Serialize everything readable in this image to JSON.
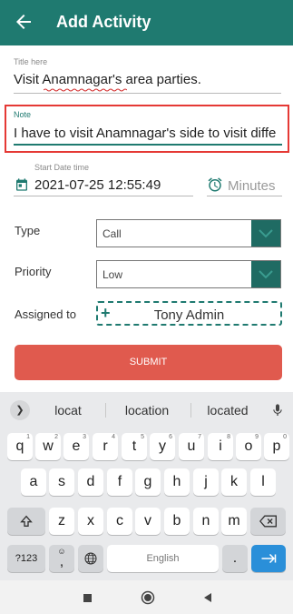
{
  "appbar": {
    "title": "Add Activity"
  },
  "form": {
    "title_label": "Title here",
    "title_value": "Visit Anamnagar's area parties.",
    "note_label": "Note",
    "note_value": "I have to visit Anamnagar's side to visit diffe",
    "start_label": "Start Date time",
    "start_value": "2021-07-25 12:55:49",
    "minutes_placeholder": "Minutes",
    "type_label": "Type",
    "type_value": "Call",
    "priority_label": "Priority",
    "priority_value": "Low",
    "assigned_label": "Assigned to",
    "assigned_value": "Tony Admin",
    "submit_label": "SUBMIT"
  },
  "keyboard": {
    "suggestions": [
      "locat",
      "location",
      "located"
    ],
    "row1": [
      {
        "k": "q",
        "h": "1"
      },
      {
        "k": "w",
        "h": "2"
      },
      {
        "k": "e",
        "h": "3"
      },
      {
        "k": "r",
        "h": "4"
      },
      {
        "k": "t",
        "h": "5"
      },
      {
        "k": "y",
        "h": "6"
      },
      {
        "k": "u",
        "h": "7"
      },
      {
        "k": "i",
        "h": "8"
      },
      {
        "k": "o",
        "h": "9"
      },
      {
        "k": "p",
        "h": "0"
      }
    ],
    "row2": [
      "a",
      "s",
      "d",
      "f",
      "g",
      "h",
      "j",
      "k",
      "l"
    ],
    "row3": [
      "z",
      "x",
      "c",
      "v",
      "b",
      "n",
      "m"
    ],
    "sym_label": "?123",
    "comma_label": ",",
    "space_label": "English",
    "period_label": "."
  },
  "colors": {
    "primary": "#1f7a70",
    "submit": "#e05a4e",
    "highlight": "#e53935",
    "enter": "#2a8fd9"
  },
  "icons": [
    "back-arrow-icon",
    "calendar-icon",
    "alarm-clock-icon",
    "chevron-down-icon",
    "plus-icon",
    "mic-icon",
    "shift-icon",
    "backspace-icon",
    "globe-icon",
    "emoji-icon",
    "enter-arrow-icon",
    "nav-back-icon",
    "nav-home-icon",
    "nav-recents-icon"
  ]
}
